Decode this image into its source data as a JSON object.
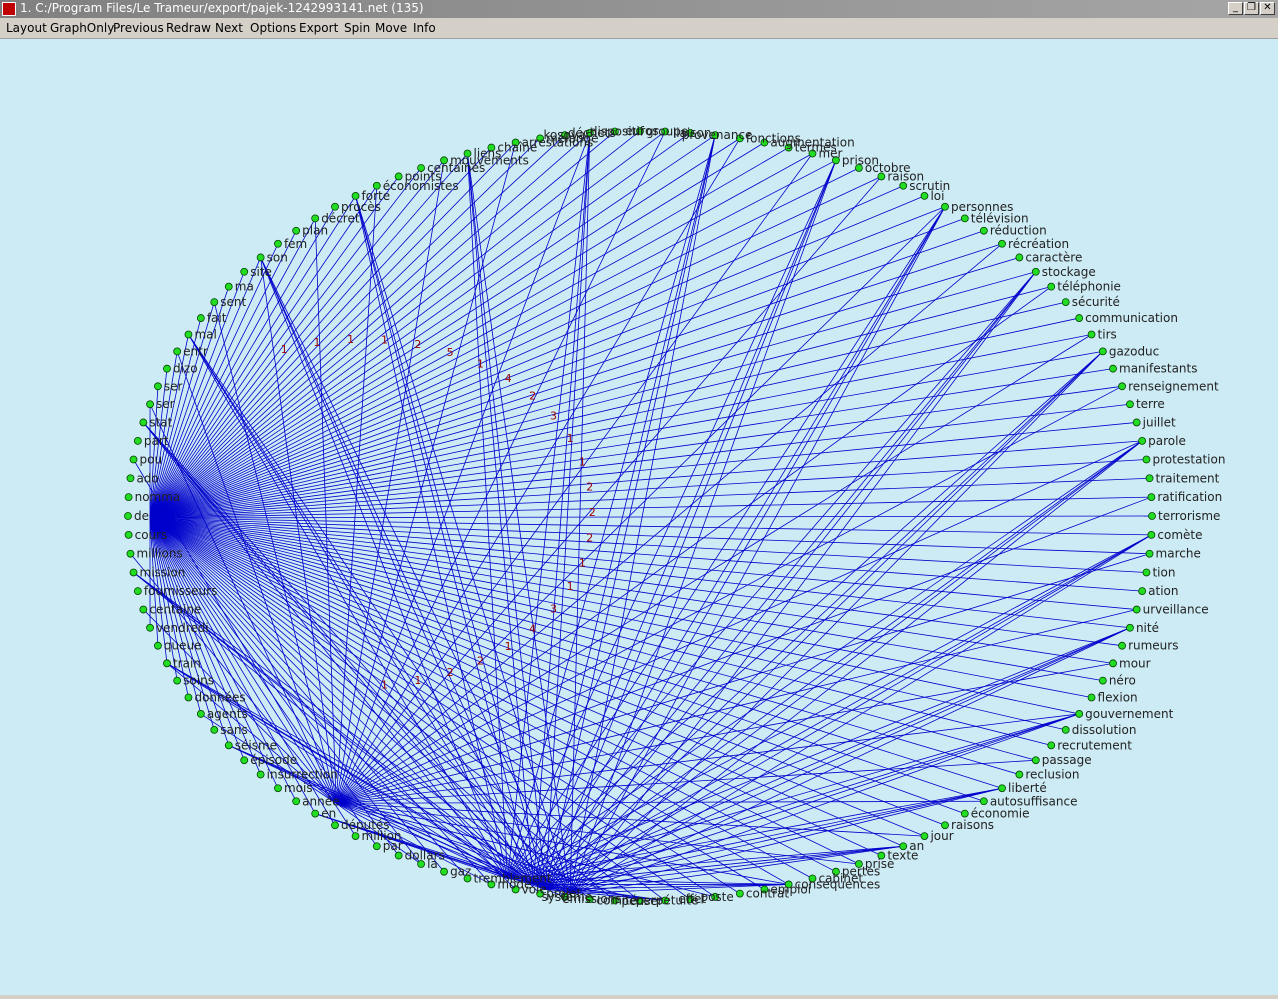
{
  "window": {
    "title": "1. C:/Program Files/Le Trameur/export/pajek-1242993141.net (135)",
    "minimize_symbol": "_",
    "maximize_symbol": "❐",
    "close_symbol": "✕"
  },
  "menu": {
    "items": [
      "Layout",
      "GraphOnly",
      "Previous",
      "Redraw",
      "Next",
      "Options",
      "Export",
      "Spin",
      "Move",
      "Info"
    ]
  },
  "colors": {
    "canvas_bg": "#cdebf4",
    "edge": "#0000cc",
    "node_fill": "#22dd22",
    "node_stroke": "#004400",
    "edge_label": "#990000",
    "label": "#222222"
  },
  "graph": {
    "node_labels": [
      "de",
      "nomma",
      "ado",
      "pou",
      "part",
      "stat",
      "ser",
      "ser",
      "dizo",
      "entr",
      "mal",
      "fait",
      "sent",
      "ma",
      "site",
      "son",
      "fem",
      "plan",
      "décret",
      "procès",
      "forte",
      "économistes",
      "points",
      "centaines",
      "mouvements",
      "liens",
      "chaîne",
      "arrestations",
      "mélange",
      "kosovar",
      "déchets",
      "dispositif",
      "euros",
      "groupe",
      "liaison",
      "provenance",
      "fonctions",
      "augmentation",
      "termes",
      "mer",
      "prison",
      "octobre",
      "raison",
      "scrutin",
      "loi",
      "personnes",
      "télévision",
      "réduction",
      "récréation",
      "caractère",
      "stockage",
      "téléphonie",
      "sécurité",
      "communication",
      "tirs",
      "gazoduc",
      "manifestants",
      "renseignement",
      "terre",
      "juillet",
      "parole",
      "protestation",
      "traitement",
      "ratification",
      "terrorisme",
      "comète",
      "marche",
      "tion",
      "ation",
      "urveillance",
      "nité",
      "rumeurs",
      "mour",
      "néro",
      "flexion",
      "gouvernement",
      "dissolution",
      "recrutement",
      "passage",
      "reclusion",
      "liberté",
      "autosuffisance",
      "économie",
      "raisons",
      "jour",
      "an",
      "texte",
      "prise",
      "pertes",
      "cabinet",
      "conséquences",
      "emploi",
      "contrat",
      "poste",
      "effet",
      "perpétuité",
      "penser",
      "comité",
      "émissions",
      "système",
      "projet",
      "voie",
      "mode",
      "tremblement",
      "gaz",
      "la",
      "dollars",
      "par",
      "million",
      "députés",
      "en",
      "année",
      "mois",
      "insurrection",
      "épisode",
      "séisme",
      "sans",
      "agents",
      "données",
      "soins",
      "train",
      "queue",
      "vendredi",
      "centaine",
      "fournisseurs",
      "mission",
      "millions",
      "cours"
    ],
    "edge_label_values": [
      "1",
      "1",
      "1",
      "1",
      "2",
      "5",
      "1",
      "4",
      "2",
      "3",
      "1",
      "1",
      "2",
      "2",
      "2",
      "1",
      "1",
      "3",
      "4",
      "1",
      "2",
      "2",
      "1",
      "1"
    ]
  }
}
